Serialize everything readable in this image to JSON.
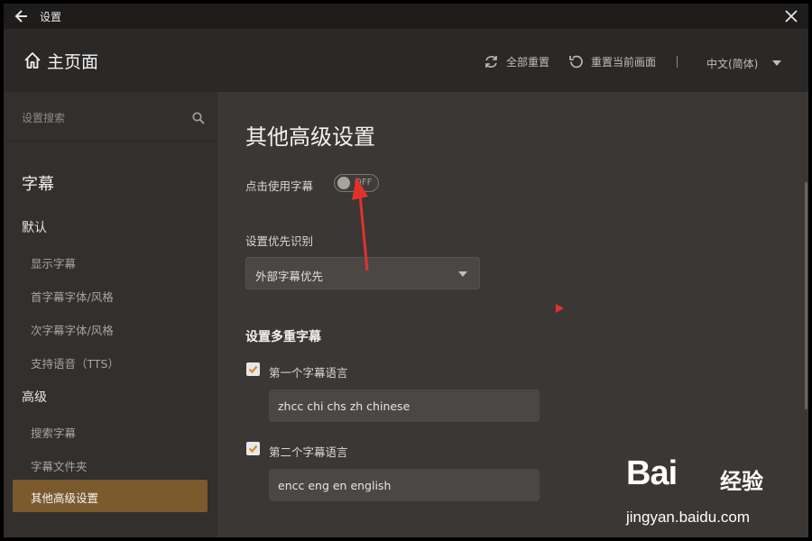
{
  "window": {
    "title": "设置"
  },
  "header": {
    "home_label": "主页面",
    "reset_all": "全部重置",
    "reset_current": "重置当前画面",
    "separator": "|",
    "language": "中文(简体)"
  },
  "sidebar": {
    "search_placeholder": "设置搜索",
    "section": "字幕",
    "groups": [
      {
        "label": "默认",
        "items": [
          "显示字幕",
          "首字幕字体/风格",
          "次字幕字体/风格",
          "支持语音（TTS）"
        ]
      },
      {
        "label": "高级",
        "items": [
          "搜索字幕",
          "字幕文件夹",
          "其他高级设置"
        ]
      }
    ],
    "active_item": "其他高级设置"
  },
  "main": {
    "title": "其他高级设置",
    "click_use_subtitle": {
      "label": "点击使用字幕",
      "state": "OFF"
    },
    "priority": {
      "label": "设置优先识别",
      "value": "外部字幕优先"
    },
    "multi_title": "设置多重字幕",
    "first_language": {
      "label": "第一个字幕语言",
      "checked": true,
      "value": "zhcc chi chs zh chinese"
    },
    "second_language": {
      "label": "第二个字幕语言",
      "checked": true,
      "value": "encc eng en english"
    }
  },
  "watermark": {
    "brand": "Bai",
    "brand_cn": "经验",
    "url": "jingyan.baidu.com"
  },
  "colors": {
    "accent": "#7b5a2e",
    "checkbox_mark": "#d98a28",
    "annotation": "#e0322c"
  }
}
